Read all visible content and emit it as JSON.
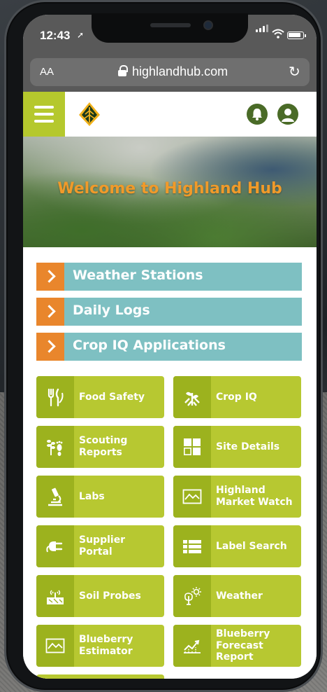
{
  "status_bar": {
    "time": "12:43"
  },
  "browser": {
    "text_size_label": "AA",
    "url": "highlandhub.com"
  },
  "hero": {
    "title": "Welcome to Highland Hub"
  },
  "accordion": [
    {
      "label": "Weather Stations"
    },
    {
      "label": "Daily Logs"
    },
    {
      "label": "Crop IQ Applications"
    }
  ],
  "tiles": [
    {
      "label": "Food Safety",
      "icon": "utensils-icon"
    },
    {
      "label": "Crop IQ",
      "icon": "plant-tools-icon"
    },
    {
      "label": "Scouting\nReports",
      "icon": "plant-footprint-icon"
    },
    {
      "label": "Site Details",
      "icon": "grid-squares-icon"
    },
    {
      "label": "Labs",
      "icon": "microscope-icon"
    },
    {
      "label": "Highland\nMarket Watch",
      "icon": "line-chart-icon"
    },
    {
      "label": "Supplier Portal",
      "icon": "plug-icon"
    },
    {
      "label": "Label Search",
      "icon": "list-icon"
    },
    {
      "label": "Soil Probes",
      "icon": "soil-probe-icon"
    },
    {
      "label": "Weather",
      "icon": "tree-sun-icon"
    },
    {
      "label": "Blueberry\nEstimator",
      "icon": "line-chart-icon"
    },
    {
      "label": "Blueberry\nForecast\nReport",
      "icon": "trend-chart-icon"
    }
  ],
  "colors": {
    "lime": "#b7c831",
    "lime_dark": "#9cb21e",
    "teal": "#7ec0c2",
    "orange": "#e9862c",
    "hero_text": "#f09a2a",
    "header_icon": "#4a6b27"
  }
}
